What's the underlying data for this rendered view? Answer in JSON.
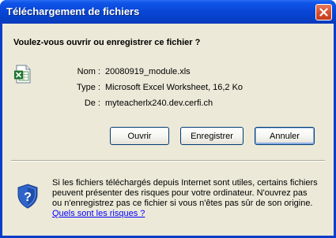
{
  "window": {
    "title": "Téléchargement de fichiers"
  },
  "dialog": {
    "question": "Voulez-vous ouvrir ou enregistrer ce fichier ?",
    "file": {
      "icon": "excel-file-icon",
      "name_label": "Nom :",
      "name_value": "20080919_module.xls",
      "type_label": "Type :",
      "type_value": "Microsoft Excel Worksheet, 16,2 Ko",
      "from_label": "De :",
      "from_value": "myteacherlx240.dev.cerfi.ch"
    },
    "buttons": {
      "open": "Ouvrir",
      "save": "Enregistrer",
      "cancel": "Annuler"
    },
    "warning": {
      "icon": "security-shield-icon",
      "text": "Si les fichiers téléchargés depuis Internet sont utiles, certains fichiers peuvent présenter des risques pour votre ordinateur. N'ouvrez pas ou n'enregistrez pas ce fichier si vous n'êtes pas sûr de son origine. ",
      "link": "Quels sont les risques ?"
    }
  },
  "colors": {
    "titlebar": "#0a47d8",
    "dialog_background": "#ece9d8",
    "close_button": "#d8512f",
    "link": "#0000ff"
  }
}
